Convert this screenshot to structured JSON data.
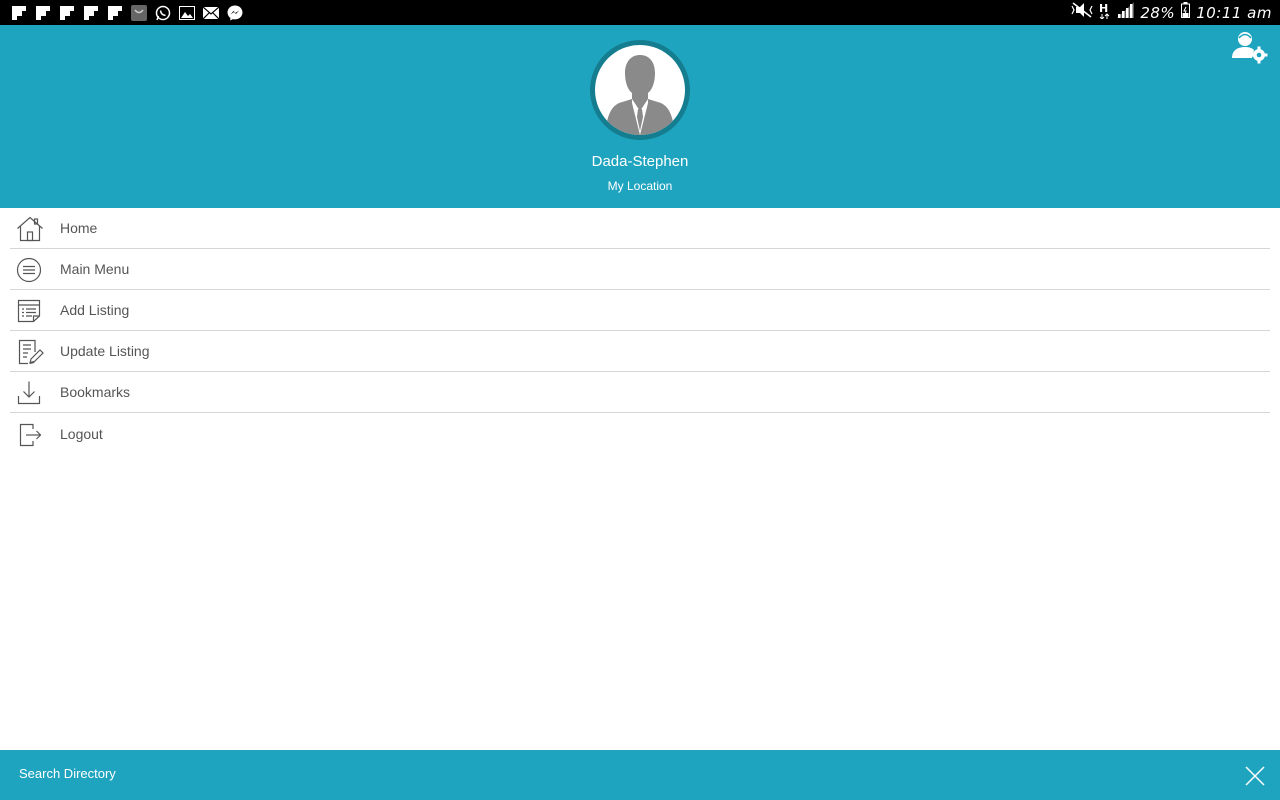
{
  "status_bar": {
    "notifications": [
      "flipboard-icon",
      "flipboard-icon",
      "flipboard-icon",
      "flipboard-icon",
      "flipboard-icon",
      "shop-icon",
      "whatsapp-icon",
      "gallery-icon",
      "email-icon",
      "messenger-icon"
    ],
    "battery": "28%",
    "time": "10:11 am"
  },
  "header": {
    "name": "Dada-Stephen",
    "location": "My Location"
  },
  "menu": {
    "items": [
      {
        "label": "Home",
        "icon": "home-icon"
      },
      {
        "label": "Main Menu",
        "icon": "menu-icon"
      },
      {
        "label": "Add Listing",
        "icon": "add-listing-icon"
      },
      {
        "label": "Update Listing",
        "icon": "edit-listing-icon"
      },
      {
        "label": "Bookmarks",
        "icon": "download-icon"
      },
      {
        "label": "Logout",
        "icon": "logout-icon"
      }
    ]
  },
  "bottom_bar": {
    "search_label": "Search Directory"
  },
  "colors": {
    "accent": "#1fa4bf",
    "avatar_ring": "#157d90"
  }
}
